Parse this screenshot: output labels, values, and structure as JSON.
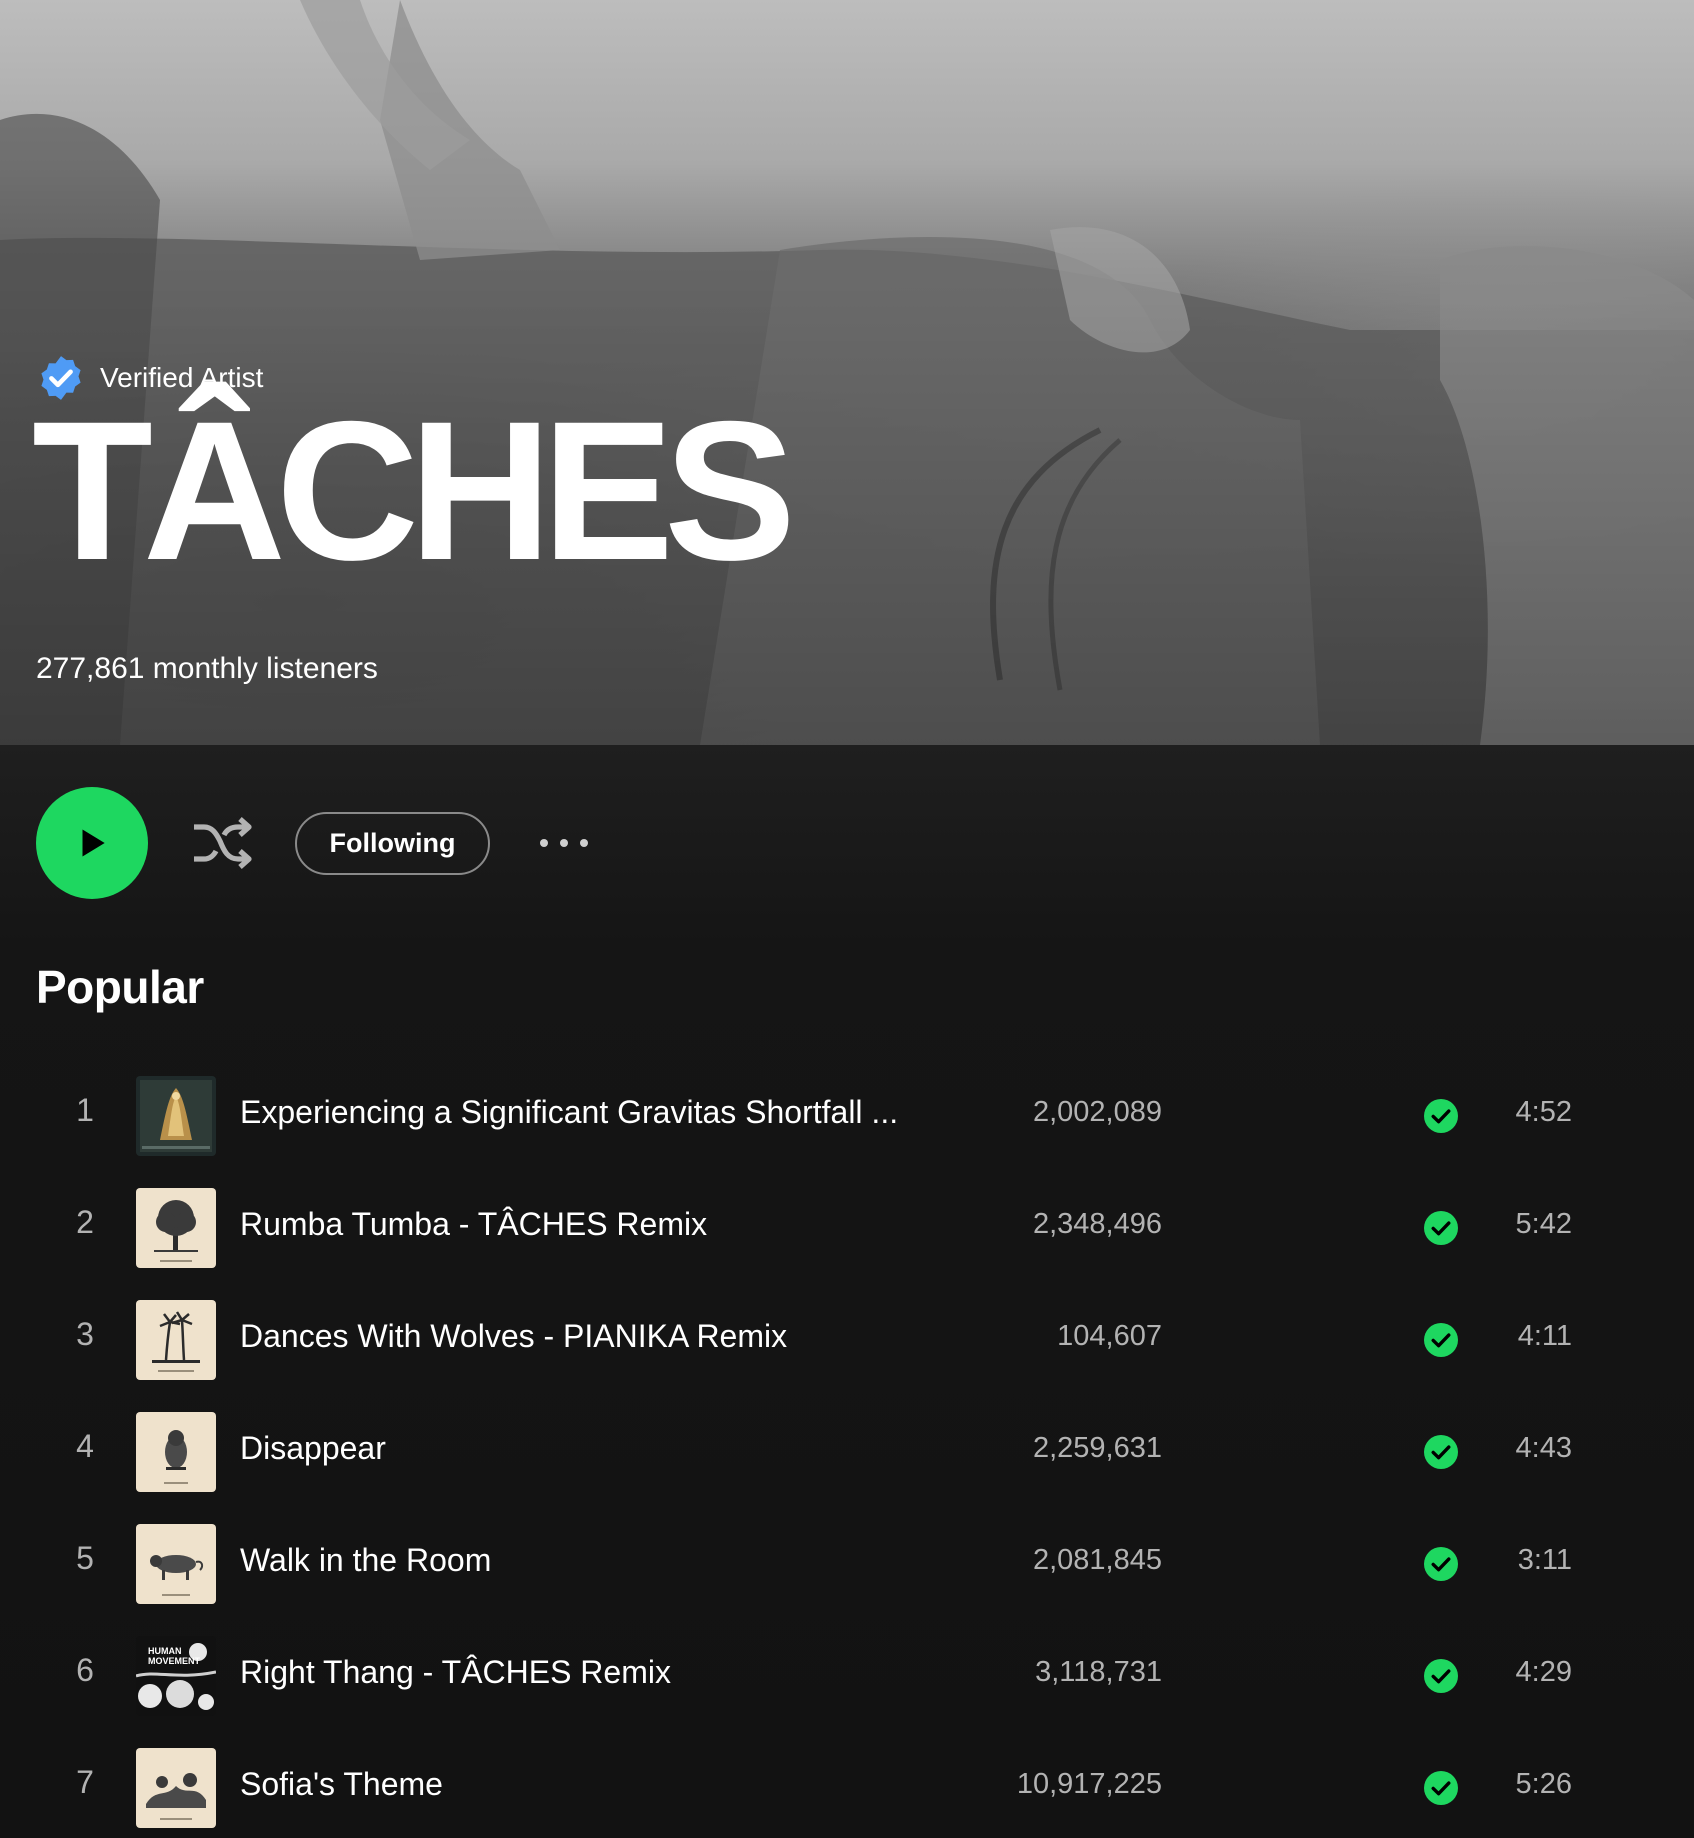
{
  "artist": {
    "verified_label": "Verified Artist",
    "name": "TÂCHES",
    "monthly_listeners": "277,861 monthly listeners"
  },
  "actions": {
    "play_icon": "play-icon",
    "shuffle_icon": "shuffle-icon",
    "follow_label": "Following",
    "more_icon": "more-options-icon"
  },
  "popular": {
    "title": "Popular",
    "tracks": [
      {
        "num": "1",
        "title": "Experiencing a Significant Gravitas Shortfall ...",
        "plays": "2,002,089",
        "duration": "4:52"
      },
      {
        "num": "2",
        "title": "Rumba Tumba - TÂCHES Remix",
        "plays": "2,348,496",
        "duration": "5:42"
      },
      {
        "num": "3",
        "title": "Dances With Wolves - PIANIKA Remix",
        "plays": "104,607",
        "duration": "4:11"
      },
      {
        "num": "4",
        "title": "Disappear",
        "plays": "2,259,631",
        "duration": "4:43"
      },
      {
        "num": "5",
        "title": "Walk in the Room",
        "plays": "2,081,845",
        "duration": "3:11"
      },
      {
        "num": "6",
        "title": "Right Thang - TÂCHES Remix",
        "plays": "3,118,731",
        "duration": "4:29"
      },
      {
        "num": "7",
        "title": "Sofia's Theme",
        "plays": "10,917,225",
        "duration": "5:26"
      }
    ],
    "art_6_text": [
      "HUMAN",
      "MOVEMENT"
    ]
  },
  "colors": {
    "accent": "#1ed760",
    "background": "#121212",
    "verified": "#4f9bf5",
    "secondary_text": "#b3b3b3"
  }
}
